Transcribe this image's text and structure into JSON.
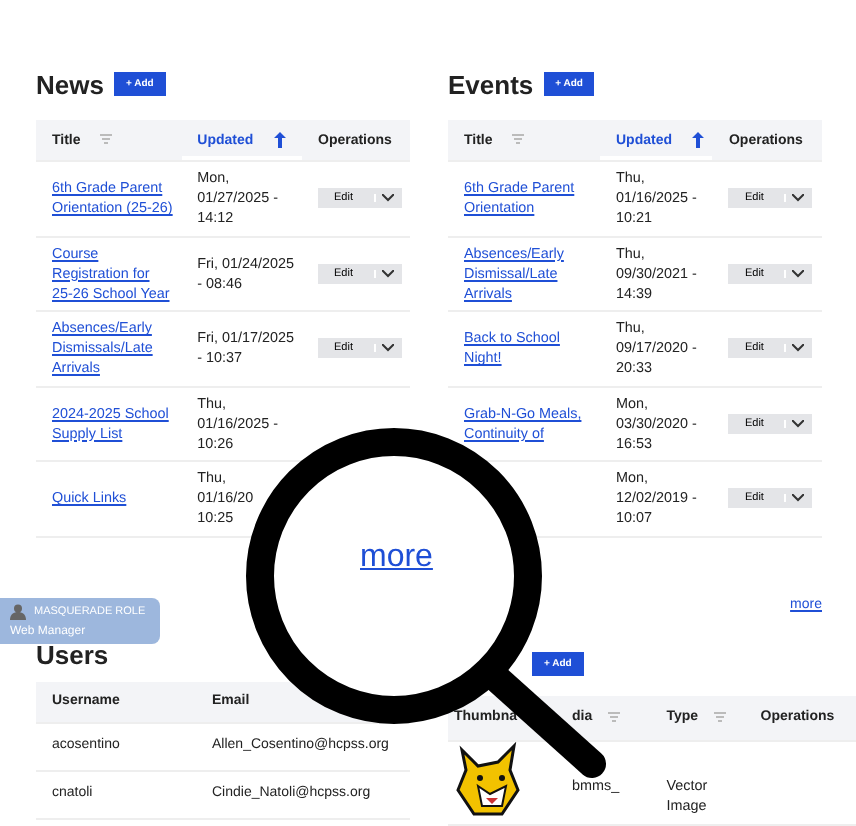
{
  "news": {
    "title": "News",
    "add_button": "+ Add",
    "columns": [
      {
        "label": "Title",
        "sorted": false
      },
      {
        "label": "Updated",
        "sorted": true
      },
      {
        "label": "Operations",
        "sorted": false
      }
    ],
    "rows": [
      {
        "title": "6th Grade Parent Orientation (25-26)",
        "date": [
          "Mon,",
          "01/27/2025 -",
          "14:12"
        ],
        "operation": "Edit"
      },
      {
        "title": "Course Registration for 25-26 School Year",
        "date": [
          "Fri, 01/24/2025",
          "- 08:46"
        ],
        "operation": "Edit"
      },
      {
        "title": "Absences/Early Dismissals/Late Arrivals",
        "date": [
          "Fri, 01/17/2025",
          "- 10:37"
        ],
        "operation": "Edit"
      },
      {
        "title": "2024-2025 School Supply List",
        "date": [
          "Thu,",
          "01/16/2025 -",
          "10:26"
        ]
      },
      {
        "title": "Quick Links",
        "date": [
          "Thu,",
          "01/16/20",
          "10:25"
        ]
      }
    ],
    "more_link": "more"
  },
  "events": {
    "title": "Events",
    "add_button": "+ Add",
    "columns": [
      {
        "label": "Title",
        "sorted": false
      },
      {
        "label": "Updated",
        "sorted": true
      },
      {
        "label": "Operations",
        "sorted": false
      }
    ],
    "rows": [
      {
        "title": "6th Grade Parent Orientation",
        "date": [
          "Thu,",
          "01/16/2025 -",
          "10:21"
        ],
        "operation": "Edit"
      },
      {
        "title": "Absences/Early Dismissal/Late Arrivals",
        "date": [
          "Thu,",
          "09/30/2021 -",
          "14:39"
        ],
        "operation": "Edit"
      },
      {
        "title": "Back to School Night!",
        "date": [
          "Thu,",
          "09/17/2020 -",
          "20:33"
        ],
        "operation": "Edit"
      },
      {
        "title": "Grab-N-Go Meals, Continuity of",
        "date": [
          "Mon,",
          "03/30/2020 -",
          "16:53"
        ],
        "operation": "Edit"
      },
      {
        "date": [
          "Mon,",
          "12/02/2019 -",
          "10:07"
        ],
        "operation": "Edit"
      }
    ],
    "more_link": "more"
  },
  "masquerade": {
    "heading": "MASQUERADE ROLE",
    "role": "Web Manager"
  },
  "users": {
    "title": "Users",
    "columns": [
      "Username",
      "Email"
    ],
    "rows": [
      [
        "acosentino",
        "Allen_Cosentino@hcpss.org"
      ],
      [
        "cnatoli",
        "Cindie_Natoli@hcpss.org"
      ]
    ]
  },
  "media": {
    "add_button": "+ Add",
    "columns": [
      {
        "label": "Thumbna"
      },
      {
        "label": "dia",
        "sortable": true
      },
      {
        "label": "Type",
        "sortable": true
      },
      {
        "label": "Operations",
        "sortable": false
      }
    ],
    "rows": [
      {
        "name": "bmms_",
        "type": "Vector Image"
      }
    ]
  }
}
